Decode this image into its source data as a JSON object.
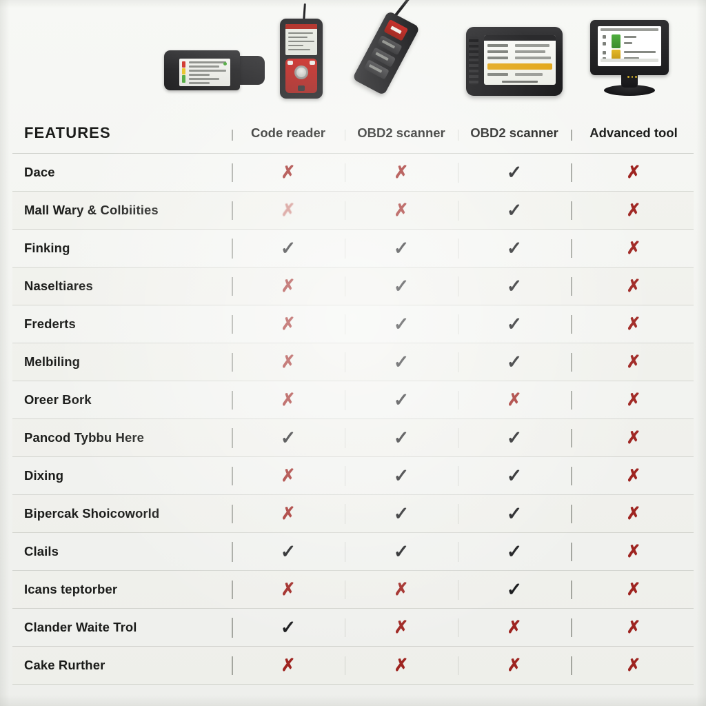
{
  "table": {
    "feature_header": "FEATURES",
    "columns": [
      {
        "id": "code-reader",
        "label": "Code reader",
        "device": "handheld-code-reader"
      },
      {
        "id": "obd2-scanner-1",
        "label": "OBD2 scanner",
        "device": "handheld-obd2-scanner"
      },
      {
        "id": "obd2-scanner-2",
        "label": "OBD2 scanner",
        "device": "tablet-obd2-scanner"
      },
      {
        "id": "advanced-tool",
        "label": "Advanced tool",
        "device": "desktop-diagnostic-software"
      }
    ],
    "rows": [
      {
        "feature": "Dace",
        "values": [
          "no",
          "no",
          "yes",
          "no"
        ]
      },
      {
        "feature": "Mall Wary & Colbiities",
        "values": [
          "faded",
          "no",
          "yes",
          "no"
        ]
      },
      {
        "feature": "Finking",
        "values": [
          "yes",
          "yes",
          "yes",
          "no"
        ]
      },
      {
        "feature": "Naseltiares",
        "values": [
          "no",
          "yes",
          "yes",
          "no"
        ]
      },
      {
        "feature": "Frederts",
        "values": [
          "no",
          "yes",
          "yes",
          "no"
        ]
      },
      {
        "feature": "Melbiling",
        "values": [
          "no",
          "yes",
          "yes",
          "no"
        ]
      },
      {
        "feature": "Oreer Bork",
        "values": [
          "no",
          "yes",
          "no",
          "no"
        ]
      },
      {
        "feature": "Pancod Tybbu Here",
        "values": [
          "yes",
          "yes",
          "yes",
          "no"
        ]
      },
      {
        "feature": "Dixing",
        "values": [
          "no",
          "yes",
          "yes",
          "no"
        ]
      },
      {
        "feature": "Bipercak Shoicoworld",
        "values": [
          "no",
          "yes",
          "yes",
          "no"
        ]
      },
      {
        "feature": "Clails",
        "values": [
          "yes",
          "yes",
          "yes",
          "no"
        ]
      },
      {
        "feature": "Icans teptorber",
        "values": [
          "no",
          "no",
          "yes",
          "no"
        ]
      },
      {
        "feature": "Clander Waite Trol",
        "values": [
          "yes",
          "no",
          "no",
          "no"
        ]
      },
      {
        "feature": "Cake Rurther",
        "values": [
          "no",
          "no",
          "no",
          "no"
        ]
      }
    ]
  },
  "marks": {
    "yes": "✓",
    "no": "✗",
    "faded": "✗"
  },
  "colors": {
    "background": "#f4f5f2",
    "text": "#1b1c1a",
    "check": "#17181a",
    "cross": "#9e2420",
    "grid_line": "#abaea7"
  },
  "devices": [
    {
      "name": "code-reader-dongle",
      "accent": "#4da83c"
    },
    {
      "name": "handheld-red-scanner",
      "accent": "#c8241f"
    },
    {
      "name": "tilted-handheld-scanner",
      "accent": "#c4221d"
    },
    {
      "name": "rugged-tablet-scanner",
      "accent": "#e3a81c"
    },
    {
      "name": "desktop-monitor-software",
      "accent": "#4fae3d"
    }
  ]
}
